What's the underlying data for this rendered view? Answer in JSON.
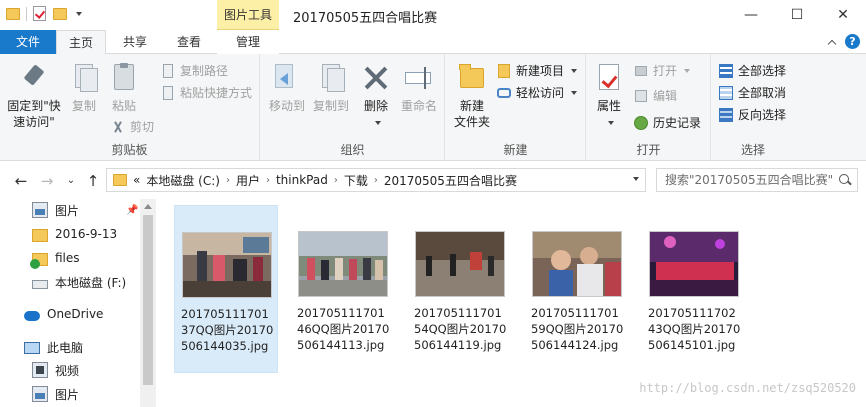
{
  "window": {
    "title": "20170505五四合唱比赛",
    "context_tab_group": "图片工具",
    "controls": {
      "minimize": "—",
      "maximize": "☐",
      "close": "✕"
    }
  },
  "tabs": [
    {
      "label": "文件",
      "active": false
    },
    {
      "label": "主页",
      "active": true
    },
    {
      "label": "共享",
      "active": false
    },
    {
      "label": "查看",
      "active": false
    },
    {
      "label": "管理",
      "active": false
    }
  ],
  "ribbon": {
    "clipboard": {
      "label": "剪贴板",
      "pin": "固定到\"快速访问\"",
      "pin_line1": "固定到\"快",
      "pin_line2": "速访问\"",
      "copy": "复制",
      "paste": "粘贴",
      "copy_path": "复制路径",
      "paste_shortcut": "粘贴快捷方式",
      "cut": "剪切"
    },
    "organize": {
      "label": "组织",
      "move_to": "移动到",
      "copy_to": "复制到",
      "delete": "删除",
      "rename": "重命名"
    },
    "new": {
      "label": "新建",
      "new_folder_line1": "新建",
      "new_folder_line2": "文件夹",
      "new_item": "新建项目",
      "easy_access": "轻松访问"
    },
    "open": {
      "label": "打开",
      "properties": "属性",
      "open": "打开",
      "edit": "编辑",
      "history": "历史记录"
    },
    "select": {
      "label": "选择",
      "select_all": "全部选择",
      "select_none": "全部取消",
      "invert": "反向选择"
    }
  },
  "address": {
    "overflow": "«",
    "crumbs": [
      "本地磁盘 (C:)",
      "用户",
      "thinkPad",
      "下载",
      "20170505五四合唱比赛"
    ],
    "search_placeholder": "搜索\"20170505五四合唱比赛\""
  },
  "nav": {
    "items": [
      {
        "label": "图片",
        "icon": "pictures-icon",
        "pinned": true
      },
      {
        "label": "2016-9-13",
        "icon": "folder-icon"
      },
      {
        "label": "files",
        "icon": "synced-folder-icon"
      },
      {
        "label": "本地磁盘 (F:)",
        "icon": "drive-icon"
      },
      {
        "label": "OneDrive",
        "icon": "onedrive-icon"
      },
      {
        "label": "此电脑",
        "icon": "this-pc-icon"
      },
      {
        "label": "视频",
        "icon": "videos-icon"
      },
      {
        "label": "图片",
        "icon": "pictures-icon"
      }
    ]
  },
  "files": [
    {
      "name": "20170511170137QQ图片20170506144035.jpg",
      "selected": true
    },
    {
      "name": "20170511170146QQ图片20170506144113.jpg",
      "selected": false
    },
    {
      "name": "20170511170154QQ图片20170506144119.jpg",
      "selected": false
    },
    {
      "name": "20170511170159QQ图片20170506144124.jpg",
      "selected": false
    },
    {
      "name": "20170511170243QQ图片20170506145101.jpg",
      "selected": false
    }
  ],
  "watermark": "http://blog.csdn.net/zsq520520"
}
